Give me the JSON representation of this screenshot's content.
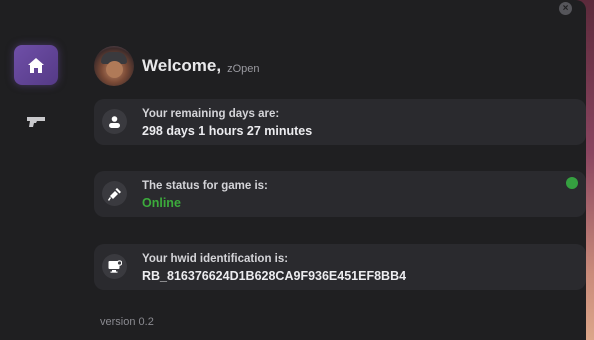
{
  "window": {
    "close_label": "×"
  },
  "sidebar": {
    "items": [
      {
        "name": "home",
        "icon": "home-icon",
        "active": true
      },
      {
        "name": "gun",
        "icon": "gun-icon",
        "active": false
      }
    ]
  },
  "header": {
    "welcome": "Welcome,",
    "username": "zOpen"
  },
  "cards": {
    "days": {
      "label": "Your remaining days are:",
      "value": "298 days 1 hours 27 minutes"
    },
    "status": {
      "label": "The status for game is:",
      "value": "Online",
      "color": "#3cab3c"
    },
    "hwid": {
      "label": "Your hwid identification is:",
      "value": "RB_816376624D1B628CA9F936E451EF8BB4"
    }
  },
  "footer": {
    "version": "version 0.2"
  },
  "colors": {
    "accent": "#6f4fa8",
    "online": "#35a040",
    "background": "#1f1f21",
    "card": "#2a2a2e"
  }
}
